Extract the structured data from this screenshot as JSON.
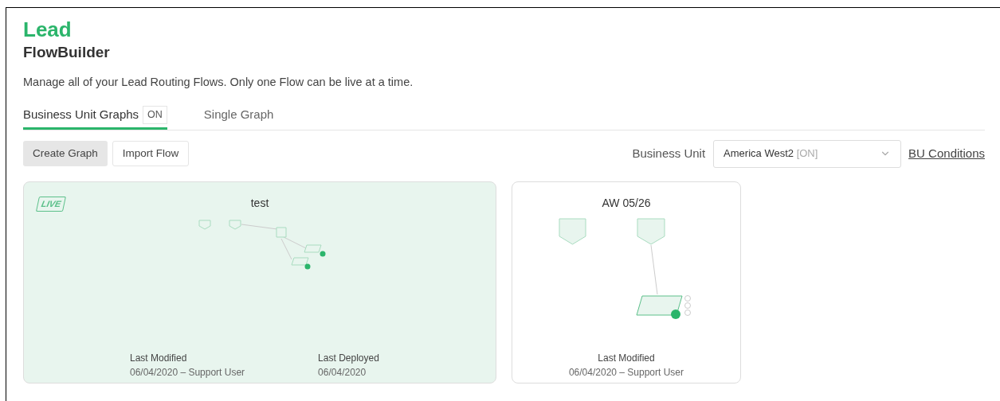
{
  "header": {
    "object": "Lead",
    "title": "FlowBuilder",
    "description": "Manage all of your Lead Routing Flows. Only one Flow can be live at a time."
  },
  "tabs": [
    {
      "label": "Business Unit Graphs",
      "badge": "ON",
      "selected": true
    },
    {
      "label": "Single Graph",
      "selected": false
    }
  ],
  "toolbar": {
    "buttons": [
      {
        "label": "Create Graph",
        "selected": true
      },
      {
        "label": "Import Flow",
        "selected": false
      }
    ],
    "business_unit": {
      "label": "Business Unit",
      "value": "America West2",
      "status": "[ON]"
    },
    "link": "BU Conditions"
  },
  "graphs": [
    {
      "title": "test",
      "live": true,
      "live_label": "LIVE",
      "meta": [
        {
          "label": "Last Modified",
          "value": "06/04/2020 – Support User"
        },
        {
          "label": "Last Deployed",
          "value": "06/04/2020"
        }
      ]
    },
    {
      "title": "AW 05/26",
      "live": false,
      "meta": [
        {
          "label": "Last Modified",
          "value": "06/04/2020 – Support User"
        }
      ]
    }
  ]
}
